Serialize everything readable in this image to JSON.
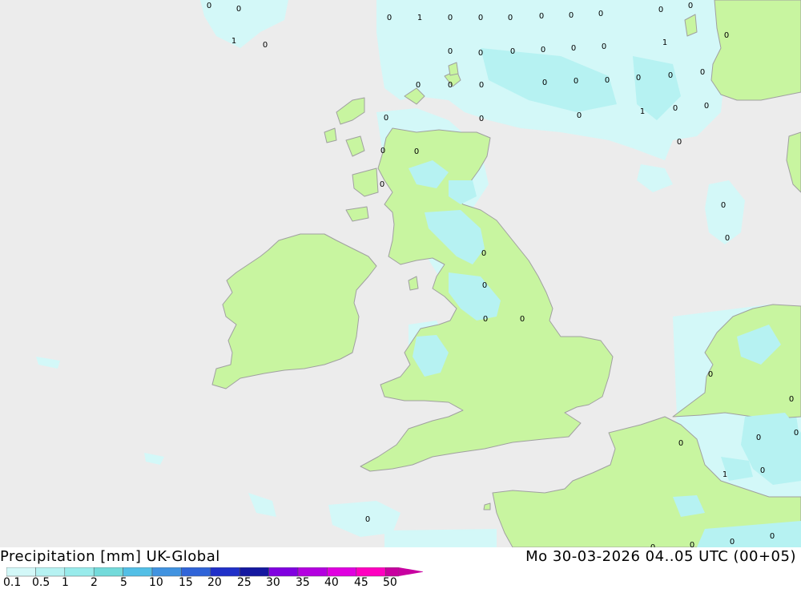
{
  "title": {
    "product": "Precipitation [mm]",
    "model": "UK-Global",
    "valid_time": "Mo 30-03-2026 04..05 UTC (00+05)"
  },
  "legend": {
    "labels": [
      "0.1",
      "0.5",
      "1",
      "2",
      "5",
      "10",
      "15",
      "20",
      "25",
      "30",
      "35",
      "40",
      "45",
      "50"
    ],
    "colors": [
      "#d3f8f8",
      "#b6f2f2",
      "#98ebeb",
      "#73dada",
      "#53bfe6",
      "#4193e0",
      "#3064d8",
      "#2030c8",
      "#1418a0",
      "#8000e0",
      "#b400e0",
      "#e000e0",
      "#ff00c0",
      "#c800a0"
    ]
  },
  "colors": {
    "sea": "#ececec",
    "land": "#c8f5a0",
    "coast": "#a0a0a0",
    "precip_light": "#d3f8f8",
    "precip_medium": "#b6f2f2"
  },
  "map_values": [
    "0",
    "0",
    "0",
    "1",
    "0",
    "0",
    "0",
    "0",
    "0",
    "0",
    "0",
    "1",
    "0",
    "0",
    "0",
    "0",
    "0",
    "0",
    "0",
    "1",
    "0",
    "0",
    "0",
    "0",
    "0",
    "0",
    "0",
    "0",
    "0",
    "0",
    "0",
    "0",
    "0",
    "0",
    "1",
    "0",
    "0",
    "0",
    "0",
    "0",
    "0",
    "0",
    "0",
    "0",
    "0",
    "0",
    "0",
    "0",
    "0",
    "0",
    "0",
    "0",
    "0",
    "1",
    "0",
    "0",
    "0",
    "0",
    "0",
    "1",
    "1"
  ]
}
